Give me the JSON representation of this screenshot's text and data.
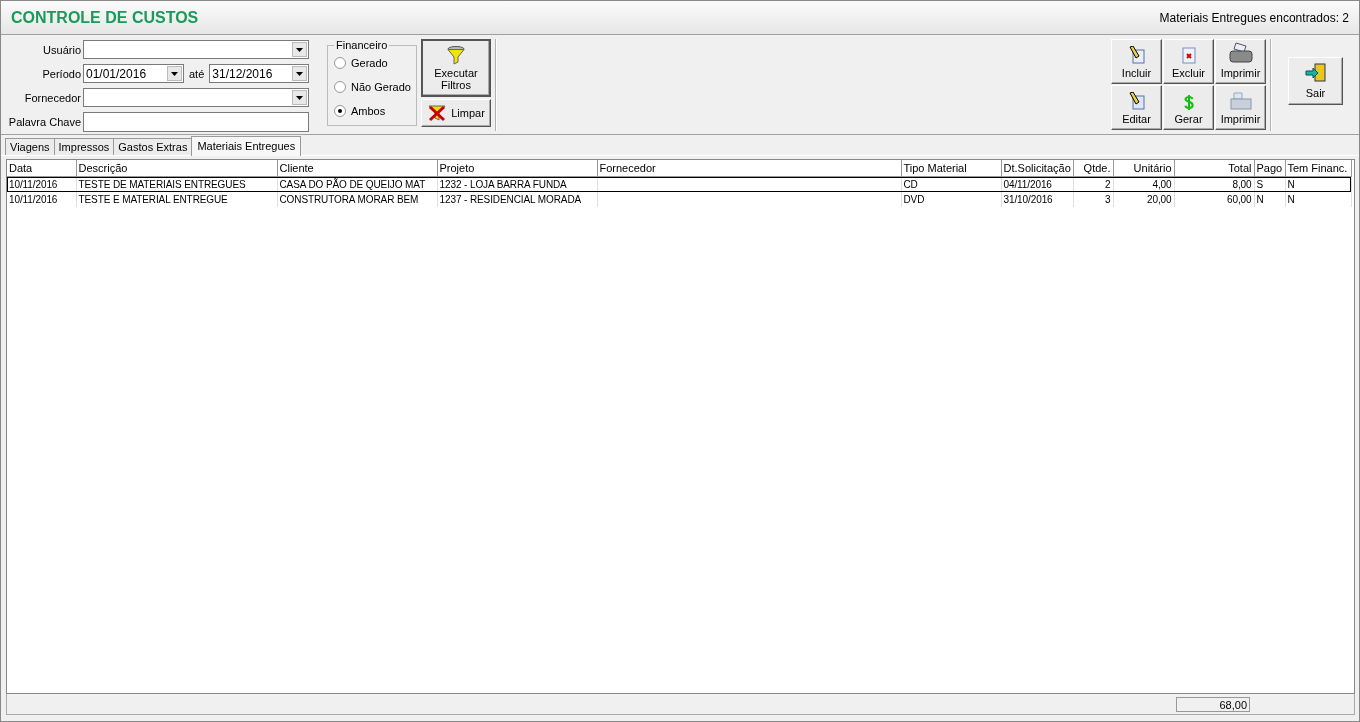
{
  "title": "CONTROLE DE CUSTOS",
  "found": "Materiais Entregues encontrados: 2",
  "filters": [
    {
      "label": "Usuário",
      "kind": "combo"
    },
    {
      "label": "Período",
      "kind": "range",
      "from": "01/01/2016",
      "separator": "até",
      "to": "31/12/2016"
    },
    {
      "label": "Fornecedor",
      "kind": "combo"
    },
    {
      "label": "Palavra Chave",
      "kind": "text"
    }
  ],
  "financeiro": {
    "legend": "Financeiro",
    "options": [
      {
        "label": "Gerado",
        "selected": false
      },
      {
        "label": "Não Gerado",
        "selected": false
      },
      {
        "label": "Ambos",
        "selected": true
      }
    ]
  },
  "filter_buttons": [
    {
      "label": "Executar Filtros",
      "kind": "run"
    },
    {
      "label": "Limpar",
      "kind": "clear"
    }
  ],
  "actions": [
    {
      "label": "Incluir",
      "kind": "new"
    },
    {
      "label": "Excluir",
      "kind": "delete"
    },
    {
      "label": "Imprimir",
      "kind": "print"
    },
    {
      "label": "Editar",
      "kind": "edit"
    },
    {
      "label": "Gerar",
      "kind": "generate"
    },
    {
      "label": "Imprimir",
      "kind": "print-list"
    }
  ],
  "exit_button": {
    "label": "Sair"
  },
  "tabs": [
    {
      "label": "Viagens",
      "selected": false
    },
    {
      "label": "Impressos",
      "selected": false
    },
    {
      "label": "Gastos Extras",
      "selected": false
    },
    {
      "label": "Materiais Entregues",
      "selected": true
    }
  ],
  "table": {
    "columns": [
      "Data",
      "Descrição",
      "Cliente",
      "Projeto",
      "Fornecedor",
      "Tipo Material",
      "Dt.Solicitação",
      "Qtde.",
      "Unitário",
      "Total",
      "Pago",
      "Tem Financ."
    ],
    "rows": [
      {
        "selected": true,
        "cells": [
          "10/11/2016",
          "TESTE DE MATERIAIS ENTREGUES",
          "CASA DO PÃO DE QUEIJO MAT",
          "1232 - LOJA BARRA FUNDA",
          null,
          "CD",
          "04/11/2016",
          "2",
          "4,00",
          "8,00",
          "S",
          "N"
        ]
      },
      {
        "selected": false,
        "cells": [
          "10/11/2016",
          "TESTE E MATERIAL ENTREGUE",
          "CONSTRUTORA MORAR BEM",
          "1237 - RESIDENCIAL MORADA",
          null,
          "DVD",
          "31/10/2016",
          "3",
          "20,00",
          "60,00",
          "N",
          "N"
        ]
      }
    ]
  },
  "footer": {
    "total": "68,00"
  }
}
